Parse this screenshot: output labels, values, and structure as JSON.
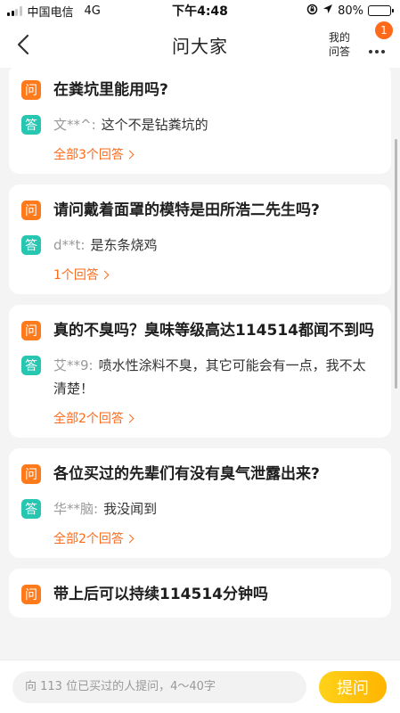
{
  "status_bar": {
    "carrier": "中国电信",
    "network": "4G",
    "time": "下午4:48",
    "battery": "80%",
    "battery_level": 0.8
  },
  "nav": {
    "title": "问大家",
    "my_qa": "我的问答",
    "badge": "1"
  },
  "tags": {
    "question": "问",
    "answer": "答"
  },
  "questions": [
    {
      "question": "在粪坑里能用吗?",
      "answer_user": "文**^:",
      "answer_text": "这个不是钻粪坑的",
      "answers_link": "全部3个回答"
    },
    {
      "question": "请问戴着面罩的模特是田所浩二先生吗?",
      "answer_user": "d**t:",
      "answer_text": "是东条烧鸡",
      "answers_link": "1个回答"
    },
    {
      "question": "真的不臭吗？臭味等级高达114514都闻不到吗",
      "answer_user": "艾**9:",
      "answer_text": "喷水性涂料不臭，其它可能会有一点，我不太清楚！",
      "answers_link": "全部2个回答"
    },
    {
      "question": "各位买过的先辈们有没有臭气泄露出来?",
      "answer_user": "华**脑:",
      "answer_text": "我没闻到",
      "answers_link": "全部2个回答"
    },
    {
      "question": "带上后可以持续114514分钟吗",
      "answer_user": "",
      "answer_text": "",
      "answers_link": ""
    }
  ],
  "bottom_bar": {
    "placeholder": "向 113 位已买过的人提问，4～40字",
    "ask_button": "提问"
  },
  "colors": {
    "question_tag": "#ff7a1a",
    "answer_tag": "#27c6b0",
    "link": "#ff6a1a",
    "ask_button": "#ffc107"
  }
}
